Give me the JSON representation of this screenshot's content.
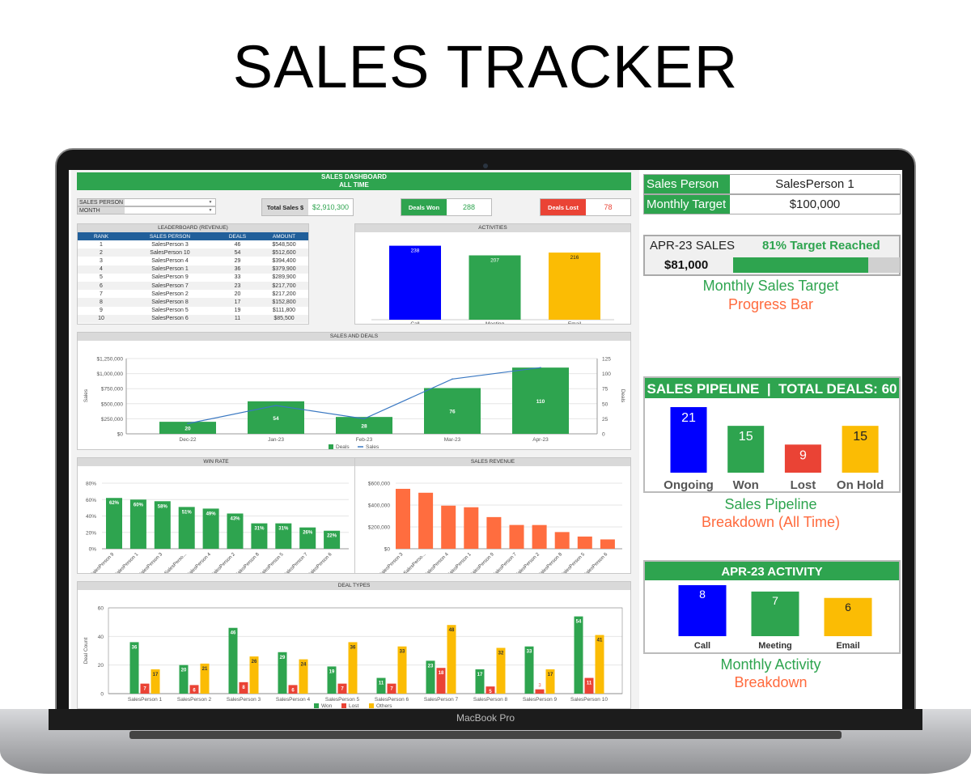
{
  "page_title": "SALES TRACKER",
  "laptop_label": "MacBook Pro",
  "colors": {
    "green": "#2ea44f",
    "blue": "#0000ff",
    "yellow": "#fbbc04",
    "red": "#ea4335",
    "orange": "#ff6d3f",
    "line": "#3a78c2",
    "leaderboard_header": "#215f9a"
  },
  "dashboard": {
    "title": "SALES DASHBOARD",
    "subtitle": "ALL TIME",
    "filters": [
      {
        "label": "SALES PERSON",
        "value": ""
      },
      {
        "label": "MONTH",
        "value": ""
      }
    ],
    "kpis": {
      "total_sales_label": "Total Sales $",
      "total_sales": "$2,910,300",
      "deals_won_label": "Deals Won",
      "deals_won": "288",
      "deals_lost_label": "Deals Lost",
      "deals_lost": "78"
    },
    "leaderboard": {
      "title": "LEADERBOARD (REVENUE)",
      "columns": [
        "RANK",
        "SALES PERSON",
        "DEALS",
        "AMOUNT"
      ],
      "rows": [
        [
          "1",
          "SalesPerson 3",
          "46",
          "$548,500"
        ],
        [
          "2",
          "SalesPerson 10",
          "54",
          "$512,600"
        ],
        [
          "3",
          "SalesPerson 4",
          "29",
          "$394,400"
        ],
        [
          "4",
          "SalesPerson 1",
          "36",
          "$379,900"
        ],
        [
          "5",
          "SalesPerson 9",
          "33",
          "$289,900"
        ],
        [
          "6",
          "SalesPerson 7",
          "23",
          "$217,700"
        ],
        [
          "7",
          "SalesPerson 2",
          "20",
          "$217,200"
        ],
        [
          "8",
          "SalesPerson 8",
          "17",
          "$152,800"
        ],
        [
          "9",
          "SalesPerson 5",
          "19",
          "$111,800"
        ],
        [
          "10",
          "SalesPerson 6",
          "11",
          "$85,500"
        ]
      ]
    }
  },
  "side": {
    "sales_person_label": "Sales Person",
    "sales_person": "SalesPerson 1",
    "monthly_target_label": "Monthly Target",
    "monthly_target": "$100,000",
    "progress": {
      "month_label": "APR-23 SALES",
      "amount": "$81,000",
      "status": "81% Target Reached",
      "percent": 81
    },
    "progress_caption": [
      "Monthly Sales Target",
      "Progress Bar"
    ],
    "pipeline_title": "SALES PIPELINE",
    "pipeline_total_label": "TOTAL DEALS:",
    "pipeline_total": "60",
    "pipeline_caption": [
      "Sales Pipeline",
      "Breakdown (All Time)"
    ],
    "activity_title": "APR-23 ACTIVITY",
    "activity_caption": [
      "Monthly Activity",
      "Breakdown"
    ]
  },
  "chart_data": [
    {
      "id": "activities",
      "type": "bar",
      "title": "ACTIVITIES",
      "categories": [
        "Call",
        "Meeting",
        "Email"
      ],
      "values": [
        238,
        207,
        216
      ],
      "colors": [
        "#0000ff",
        "#2ea44f",
        "#fbbc04"
      ]
    },
    {
      "id": "sales_deals",
      "type": "bar+line",
      "title": "SALES AND DEALS",
      "categories": [
        "Dec-22",
        "Jan-23",
        "Feb-23",
        "Mar-23",
        "Apr-23"
      ],
      "series": [
        {
          "name": "Deals",
          "type": "bar",
          "axis": "right",
          "values": [
            20,
            54,
            28,
            76,
            110
          ]
        },
        {
          "name": "Sales",
          "type": "line",
          "axis": "left",
          "values": [
            170000,
            470000,
            250000,
            910000,
            1100000
          ]
        }
      ],
      "ylabel": "Sales",
      "y2label": "Deals",
      "ylim": [
        0,
        1250000
      ],
      "y2lim": [
        0,
        125
      ],
      "y_ticks": [
        "$0",
        "$250,000",
        "$500,000",
        "$750,000",
        "$1,000,000",
        "$1,250,000"
      ],
      "y2_ticks": [
        "0",
        "25",
        "50",
        "75",
        "100",
        "125"
      ],
      "legend": "bottom",
      "grid": true
    },
    {
      "id": "win_rate",
      "type": "bar",
      "title": "WIN RATE",
      "categories": [
        "SalesPerson 9",
        "SalesPerson 1",
        "SalesPerson 3",
        "SalesPerso...",
        "SalesPerson 4",
        "SalesPerson 2",
        "SalesPerson 8",
        "SalesPerson 5",
        "SalesPerson 7",
        "SalesPerson 6"
      ],
      "values": [
        62,
        60,
        58,
        51,
        49,
        43,
        31,
        31,
        26,
        22
      ],
      "data_labels": [
        "62%",
        "60%",
        "58%",
        "51%",
        "49%",
        "43%",
        "31%",
        "31%",
        "26%",
        "22%"
      ],
      "y_ticks": [
        "0%",
        "20%",
        "40%",
        "60%",
        "80%"
      ],
      "ylim": [
        0,
        80
      ],
      "grid": true
    },
    {
      "id": "sales_revenue",
      "type": "bar",
      "title": "SALES REVENUE",
      "categories": [
        "SalesPerson 3",
        "SalesPerso...",
        "SalesPerson 4",
        "SalesPerson 1",
        "SalesPerson 9",
        "SalesPerson 7",
        "SalesPerson 2",
        "SalesPerson 8",
        "SalesPerson 5",
        "SalesPerson 6"
      ],
      "values": [
        548500,
        512600,
        394400,
        379900,
        289900,
        217700,
        217200,
        152800,
        111800,
        85500
      ],
      "y_ticks": [
        "$0",
        "$200,000",
        "$400,000",
        "$600,000"
      ],
      "ylim": [
        0,
        600000
      ],
      "grid": true
    },
    {
      "id": "deal_types",
      "type": "grouped-bar",
      "title": "DEAL TYPES",
      "ylabel": "Deal Count",
      "categories": [
        "SalesPerson 1",
        "SalesPerson 2",
        "SalesPerson 3",
        "SalesPerson 4",
        "SalesPerson 5",
        "SalesPerson 6",
        "SalesPerson 7",
        "SalesPerson 8",
        "SalesPerson 9",
        "SalesPerson 10"
      ],
      "series": [
        {
          "name": "Won",
          "color": "#2ea44f",
          "values": [
            36,
            20,
            46,
            29,
            19,
            11,
            23,
            17,
            33,
            54
          ]
        },
        {
          "name": "Lost",
          "color": "#ea4335",
          "values": [
            7,
            6,
            8,
            6,
            7,
            7,
            18,
            5,
            3,
            11
          ]
        },
        {
          "name": "Others",
          "color": "#fbbc04",
          "values": [
            17,
            21,
            26,
            24,
            36,
            33,
            48,
            32,
            17,
            41
          ]
        }
      ],
      "y_ticks": [
        "0",
        "20",
        "40",
        "60"
      ],
      "ylim": [
        0,
        60
      ],
      "legend": "bottom",
      "grid": true
    },
    {
      "id": "pipeline",
      "type": "bar",
      "categories": [
        "Ongoing",
        "Won",
        "Lost",
        "On Hold"
      ],
      "values": [
        21,
        15,
        9,
        15
      ],
      "colors": [
        "#0000ff",
        "#2ea44f",
        "#ea4335",
        "#fbbc04"
      ]
    },
    {
      "id": "apr_activity",
      "type": "bar",
      "categories": [
        "Call",
        "Meeting",
        "Email"
      ],
      "values": [
        8,
        7,
        6
      ],
      "colors": [
        "#0000ff",
        "#2ea44f",
        "#fbbc04"
      ]
    }
  ]
}
